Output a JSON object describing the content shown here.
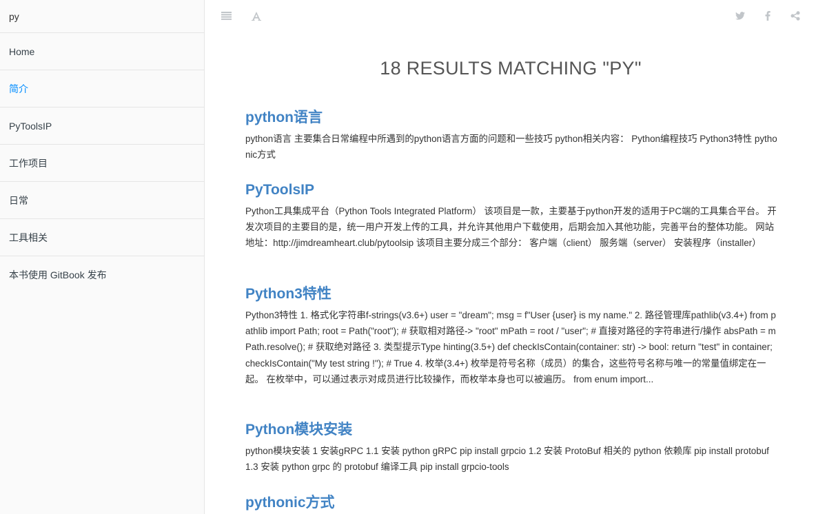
{
  "search": {
    "value": "py"
  },
  "sidebar": {
    "items": [
      {
        "label": "Home"
      },
      {
        "label": "简介"
      },
      {
        "label": "PyToolsIP"
      },
      {
        "label": "工作项目"
      },
      {
        "label": "日常"
      },
      {
        "label": "工具相关"
      },
      {
        "label": "本书使用 GitBook 发布"
      }
    ],
    "active_index": 1
  },
  "toolbar": {
    "left_icons": [
      "menu-icon",
      "font-settings-icon"
    ],
    "right_icons": [
      "twitter-icon",
      "facebook-icon",
      "share-icon"
    ]
  },
  "main": {
    "results_title": "18 RESULTS MATCHING \"PY\"",
    "results": [
      {
        "title": "python语言",
        "body": "python语言 主要集合日常编程中所遇到的python语言方面的问题和一些技巧 python相关内容： Python编程技巧 Python3特性 pythonic方式"
      },
      {
        "title": "PyToolsIP",
        "body": "Python工具集成平台（Python Tools Integrated Platform） 该项目是一款，主要基于python开发的适用于PC端的工具集合平台。 开发次项目的主要目的是，统一用户开发上传的工具，并允许其他用户下载使用，后期会加入其他功能，完善平台的整体功能。 网站地址：http://jimdreamheart.club/pytoolsip 该项目主要分成三个部分： 客户端（client） 服务端（server） 安装程序（installer）"
      },
      {
        "title": "Python3特性",
        "body": "Python3特性 1. 格式化字符串f-strings(v3.6+) user = \"dream\"; msg = f\"User {user} is my name.\" 2. 路径管理库pathlib(v3.4+) from pathlib import Path; root = Path(\"root\"); # 获取相对路径-> \"root\" mPath = root / \"user\"; # 直接对路径的字符串进行/操作 absPath = mPath.resolve(); # 获取绝对路径 3. 类型提示Type hinting(3.5+) def checkIsContain(container: str) -> bool: return \"test\" in container; checkIsContain(\"My test string !\"); # True 4. 枚举(3.4+) 枚举是符号名称（成员）的集合，这些符号名称与唯一的常量值绑定在一起。 在枚举中，可以通过表示对成员进行比较操作，而枚举本身也可以被遍历。 from enum import..."
      },
      {
        "title": "Python模块安装",
        "body": "python模块安装 1 安装gRPC 1.1 安装 python gRPC pip install grpcio 1.2 安装 ProtoBuf 相关的 python 依赖库 pip install protobuf 1.3 安装 python grpc 的 protobuf 编译工具 pip install grpcio-tools"
      },
      {
        "title": "pythonic方式",
        "body": ""
      }
    ]
  }
}
